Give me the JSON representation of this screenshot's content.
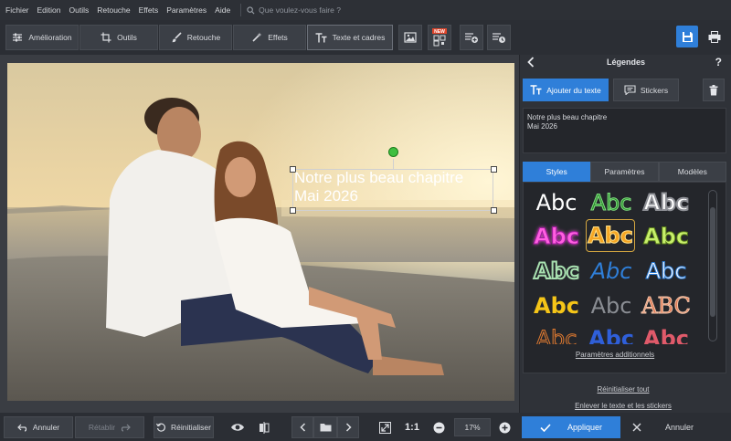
{
  "menu": {
    "items": [
      "Fichier",
      "Edition",
      "Outils",
      "Retouche",
      "Effets",
      "Paramètres",
      "Aide"
    ],
    "search_placeholder": "Que voulez-vous faire ?"
  },
  "toolbar": {
    "tabs": [
      "Amélioration",
      "Outils",
      "Retouche",
      "Effets",
      "Texte et cadres"
    ],
    "new_badge": "NEW"
  },
  "canvas": {
    "overlay_line1": "Notre plus beau chapitre",
    "overlay_line2": "Mai 2026"
  },
  "bottombar": {
    "undo": "Annuler",
    "redo": "Rétablir",
    "reset": "Réinitialiser",
    "ratio": "1:1",
    "zoom": "17%"
  },
  "panel": {
    "title": "Légendes",
    "help": "?",
    "add_text": "Ajouter du texte",
    "stickers": "Stickers",
    "text_line1": "Notre plus beau chapitre",
    "text_line2": "Mai 2026",
    "style_tabs": [
      "Styles",
      "Paramètres",
      "Modèles"
    ],
    "style_sample": "Abc",
    "style_sample_caps": "ABC",
    "more_params": "Paramètres additionnels",
    "reset_all": "Réinitialiser tout",
    "remove_all": "Enlever le texte et les stickers",
    "apply": "Appliquer",
    "cancel": "Annuler"
  },
  "colors": {
    "accent": "#2f7fd9",
    "rotate_handle": "#3fbf3f"
  }
}
